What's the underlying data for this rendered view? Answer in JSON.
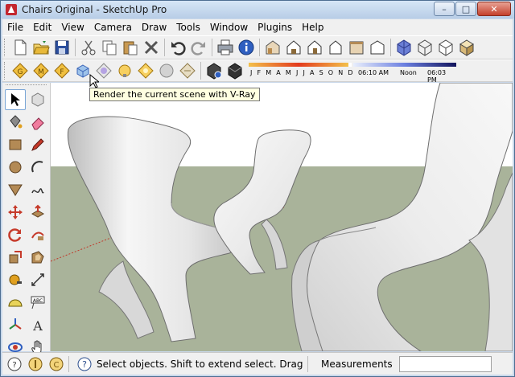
{
  "window": {
    "title": "Chairs Original - SketchUp Pro",
    "minimize_label": "–",
    "maximize_label": "□",
    "close_label": "✕"
  },
  "menu": {
    "items": [
      "File",
      "Edit",
      "View",
      "Camera",
      "Draw",
      "Tools",
      "Window",
      "Plugins",
      "Help"
    ]
  },
  "toolbar": {
    "shadow_months": "J F M A M J J A S O N D",
    "time_start": "06:10 AM",
    "time_noon": "Noon",
    "time_end": "06:03 PM"
  },
  "tooltip": {
    "text": "Render the current scene with V-Ray"
  },
  "status": {
    "message": "Select objects. Shift to extend select. Drag mouse",
    "measurements_label": "Measurements",
    "measurements_value": ""
  },
  "colors": {
    "sky": "#ffffff",
    "ground": "#a9b39a",
    "chair": "#f2f2f2",
    "accent_blue": "#3a64b8"
  },
  "icons": {
    "row1": [
      "new-file-icon",
      "open-file-icon",
      "save-icon",
      "cut-icon",
      "copy-icon",
      "paste-icon",
      "erase-icon",
      "undo-icon",
      "redo-icon",
      "print-icon",
      "model-info-icon",
      "iso-view-icon",
      "top-view-icon",
      "front-view-icon",
      "right-view-icon",
      "back-view-icon",
      "left-view-icon",
      "xray-icon",
      "wireframe-icon",
      "hidden-line-icon",
      "shaded-icon"
    ],
    "row2": [
      "vray-options-icon",
      "vray-material-editor-icon",
      "vray-frame-buffer-icon",
      "vray-render-icon",
      "vray-rt-icon",
      "vray-sphere-light-icon",
      "vray-omni-light-icon",
      "vray-dome-light-icon",
      "vray-ies-light-icon",
      "vray-infinite-plane-icon",
      "shadow-settings-icon",
      "shadows-toggle-icon"
    ]
  }
}
